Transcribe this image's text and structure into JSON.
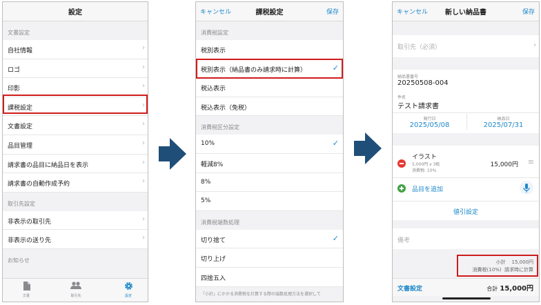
{
  "screen1": {
    "title": "設定",
    "section_document": "文書設定",
    "items": [
      "自社情報",
      "ロゴ",
      "印影",
      "課税設定",
      "文書設定",
      "品目管理",
      "請求書の品目に納品日を表示",
      "請求書の自動作成予約"
    ],
    "section_clients": "取引先設定",
    "client_items": [
      "非表示の取引先",
      "非表示の送り先"
    ],
    "section_news": "お知らせ",
    "tabs": [
      {
        "label": "文書",
        "icon": "document-icon"
      },
      {
        "label": "取引先",
        "icon": "people-icon"
      },
      {
        "label": "設定",
        "icon": "gear-icon"
      }
    ]
  },
  "screen2": {
    "cancel": "キャンセル",
    "title": "課税設定",
    "save": "保存",
    "section_tax_display": "消費税設定",
    "tax_display_options": [
      "税別表示",
      "税別表示（納品書のみ請求時に計算）",
      "税込表示",
      "税込表示（免税）"
    ],
    "section_tax_class": "消費税区分設定",
    "tax_class_options": [
      "10%",
      "軽減8%",
      "8%",
      "5%"
    ],
    "section_rounding": "消費税端数処理",
    "rounding_options": [
      "切り捨て",
      "切り上げ",
      "四捨五入"
    ],
    "footer_note": "「小計」にかかる消費税を計算する際の端数処理方法を選択して"
  },
  "screen3": {
    "cancel": "キャンセル",
    "title": "新しい納品書",
    "save": "保存",
    "client_placeholder": "取引先（必須）",
    "doc_number_label": "納品書番号",
    "doc_number": "20250508-004",
    "subject_label": "件名",
    "subject": "テスト請求書",
    "issue_date_label": "発行日",
    "issue_date": "2025/05/08",
    "delivery_date_label": "納品日",
    "delivery_date": "2025/07/31",
    "item_name": "イラスト",
    "item_detail": "5,000円 x 3枚",
    "item_tax": "消費税: 10%",
    "item_amount": "15,000円",
    "add_item": "品目を追加",
    "discount": "値引設定",
    "notes_placeholder": "備考",
    "subtotal_label": "小計",
    "subtotal_value": "15,000円",
    "tax_label": "消費税(10%)",
    "tax_value": "請求時に計算",
    "doc_settings": "文書設定",
    "total_label": "合計",
    "total_value": "15,000円"
  },
  "colors": {
    "accent": "#1e88c9",
    "highlight": "#d01b1b",
    "arrow": "#1f4e79",
    "delete": "#e53935",
    "add": "#43a047"
  }
}
